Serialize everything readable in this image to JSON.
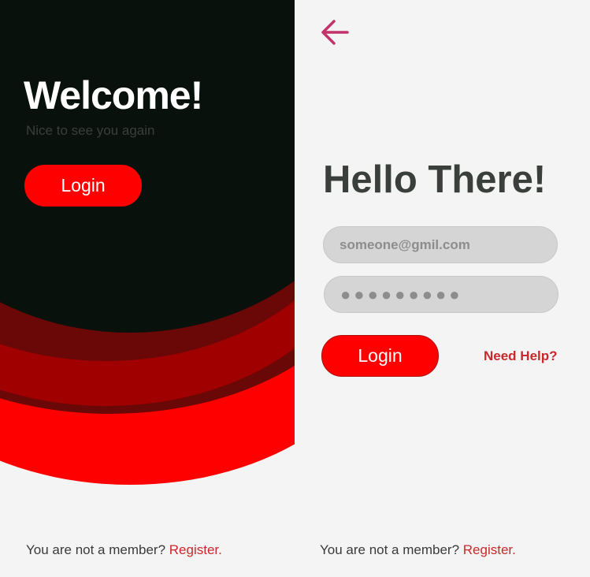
{
  "left_screen": {
    "title": "Welcome!",
    "subtitle": "Nice to see you again",
    "login_label": "Login",
    "member_text": "You are not a member?",
    "register_link": "Register."
  },
  "right_screen": {
    "back_icon": "arrow-left-icon",
    "title": "Hello There!",
    "email_placeholder": "someone@gmil.com",
    "password_value": "●●●●●●●●●",
    "login_label": "Login",
    "help_link": "Need Help?",
    "member_text": "You are not a member?",
    "register_link": "Register."
  },
  "colors": {
    "accent_red": "#fe0000",
    "dark_red": "#a00000",
    "shadow_red": "#6a0707",
    "near_black": "#08110b",
    "link_red": "#c9282c",
    "back_arrow": "#c2336b"
  }
}
